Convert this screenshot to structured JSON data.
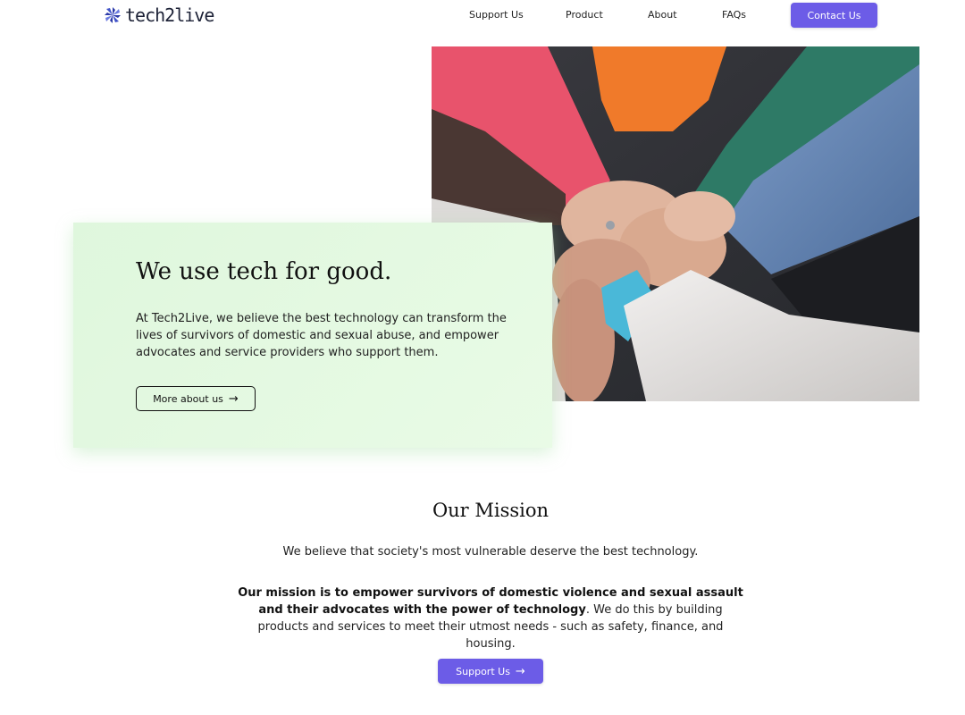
{
  "header": {
    "logo_text": "tech2live",
    "logo_icon": "asterisk-logo-icon",
    "nav": [
      {
        "label": "Support Us"
      },
      {
        "label": "Product"
      },
      {
        "label": "About"
      },
      {
        "label": "FAQs"
      }
    ],
    "contact_label": "Contact Us",
    "accent_color": "#6c5ce7"
  },
  "hero": {
    "title": "We use tech for good.",
    "text": "At Tech2Live, we believe the best technology can transform the lives of survivors of domestic and sexual abuse, and empower advocates and service providers who support them.",
    "button_label": "More about us",
    "button_icon": "arrow-right-icon",
    "card_color": "#dff7dd"
  },
  "mission": {
    "title": "Our Mission",
    "subtitle": "We believe that society's most vulnerable deserve the best technology.",
    "body_bold": "Our mission is to empower survivors of domestic violence and sexual assault and their advocates with the power of technology",
    "body_rest": ". We do this by building products and services to meet their utmost needs - such as safety, finance, and housing.",
    "button_label": "Support Us",
    "button_icon": "arrow-right-icon"
  }
}
